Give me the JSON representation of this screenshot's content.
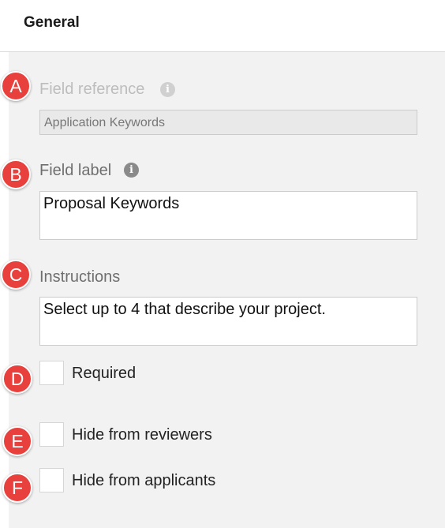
{
  "header": {
    "title": "General"
  },
  "fields": {
    "field_reference": {
      "label": "Field reference",
      "value": "Application Keywords"
    },
    "field_label": {
      "label": "Field label",
      "value": "Proposal Keywords"
    },
    "instructions": {
      "label": "Instructions",
      "value": "Select up to 4 that describe your project."
    }
  },
  "checkboxes": {
    "required": {
      "label": "Required",
      "checked": false
    },
    "hide_reviewers": {
      "label": "Hide from reviewers",
      "checked": false
    },
    "hide_applicants": {
      "label": "Hide from applicants",
      "checked": false
    }
  },
  "markers": [
    "A",
    "B",
    "C",
    "D",
    "E",
    "F"
  ],
  "icons": {
    "info_glyph": "i",
    "info_icon": "info-circle-icon"
  },
  "colors": {
    "marker": "#e8403c",
    "panel": "#f2f2f2"
  }
}
